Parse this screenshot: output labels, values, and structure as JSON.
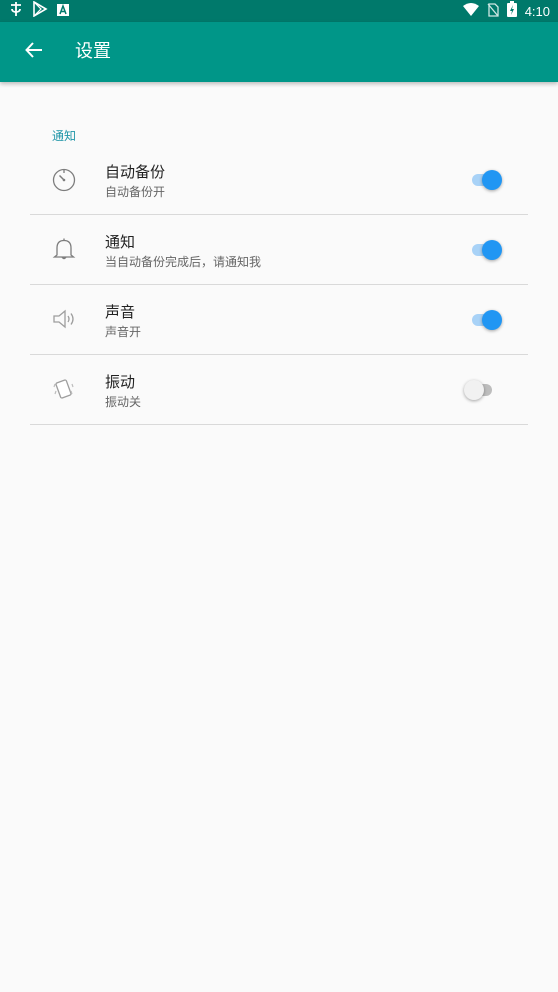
{
  "status_bar": {
    "time": "4:10",
    "left_icons": [
      "bug-icon",
      "play-store-icon",
      "font-icon"
    ],
    "right_icons": [
      "wifi-icon",
      "no-sim-icon",
      "battery-charging-icon"
    ],
    "background": "#00796b"
  },
  "toolbar": {
    "title": "设置",
    "back_icon": "arrow-back-icon",
    "background": "#009688"
  },
  "section": {
    "header": "通知",
    "header_color": "#2196a8"
  },
  "settings": [
    {
      "icon": "timer-icon",
      "title": "自动备份",
      "summary": "自动备份开",
      "enabled": true
    },
    {
      "icon": "bell-icon",
      "title": "通知",
      "summary": "当自动备份完成后，请通知我",
      "enabled": true
    },
    {
      "icon": "speaker-icon",
      "title": "声音",
      "summary": "声音开",
      "enabled": true
    },
    {
      "icon": "vibrate-icon",
      "title": "振动",
      "summary": "振动关",
      "enabled": false
    }
  ],
  "colors": {
    "toggle_on": "#2196f3",
    "toggle_on_track": "#a8d2f7",
    "toggle_off_track": "#bdbdbd"
  }
}
